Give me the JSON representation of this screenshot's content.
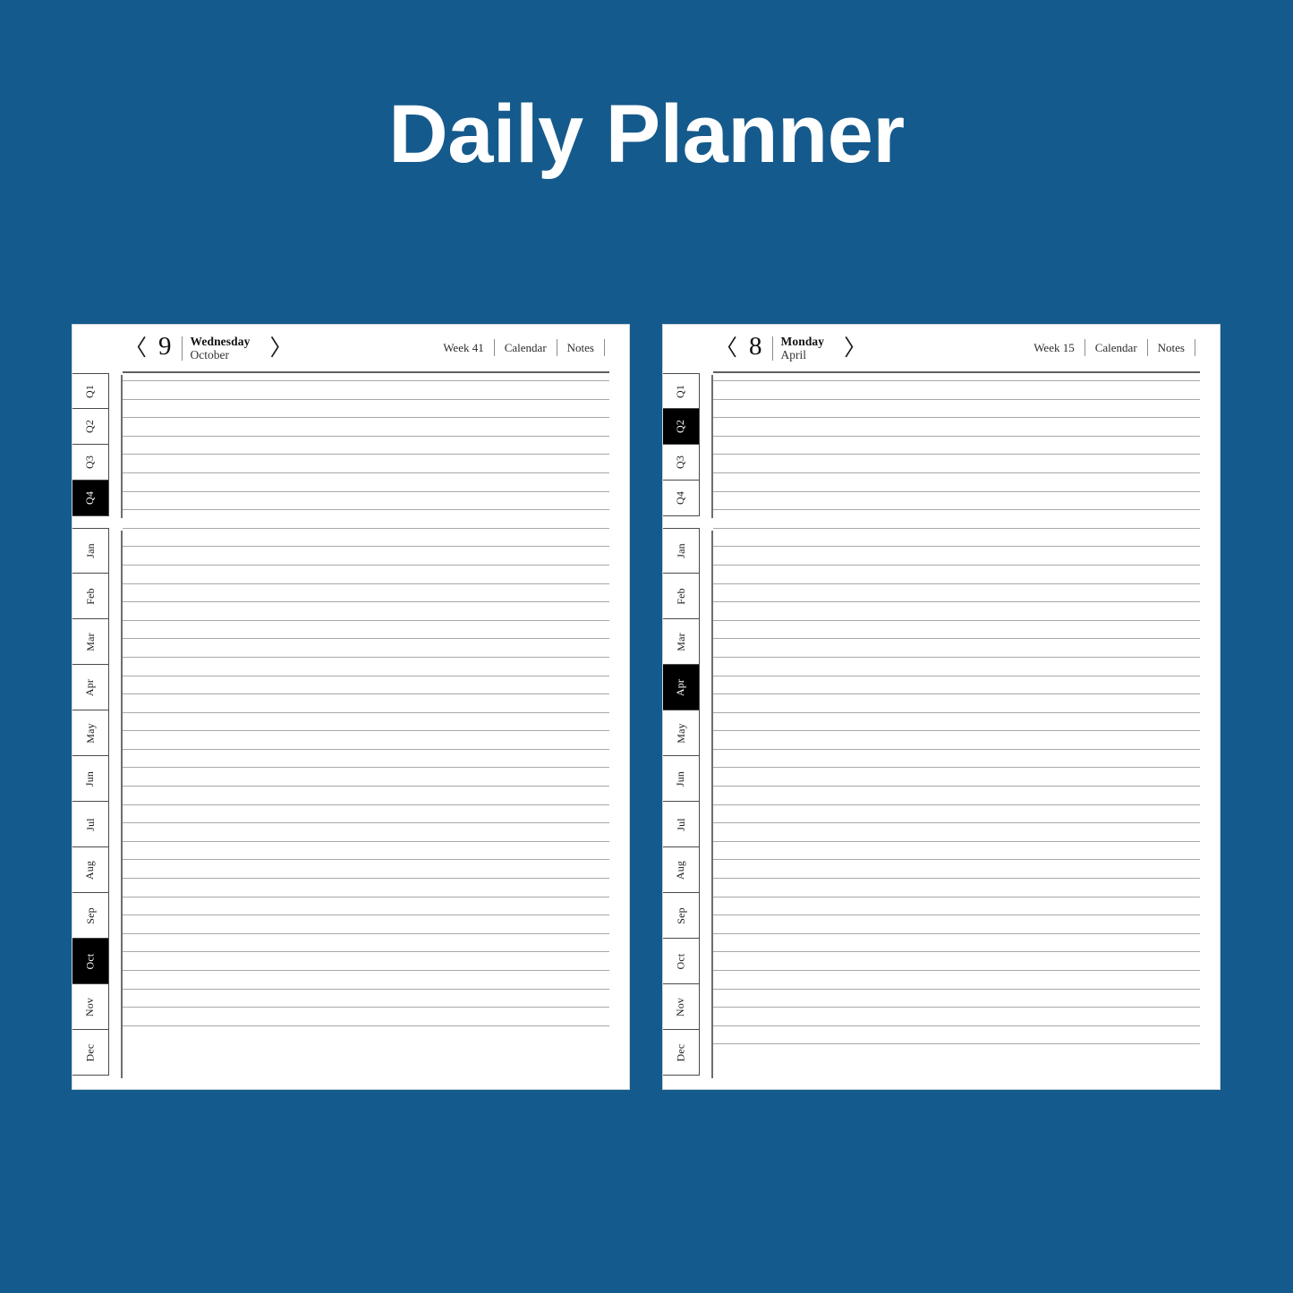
{
  "poster": {
    "title": "Daily Planner",
    "background_color": "#155A8C",
    "title_color": "#FFFFFF"
  },
  "accent": {
    "active_tab_bg": "#000000",
    "active_tab_text": "#FFFFFF",
    "rule_line_color": "#A8A8A8",
    "page_bg": "#FFFFFF"
  },
  "common": {
    "prev_icon": "〈",
    "next_icon": "〉",
    "quarter_tabs": [
      "Q1",
      "Q2",
      "Q3",
      "Q4"
    ],
    "month_tabs": [
      "Jan",
      "Feb",
      "Mar",
      "Apr",
      "May",
      "Jun",
      "Jul",
      "Aug",
      "Sep",
      "Oct",
      "Nov",
      "Dec"
    ],
    "header_links": [
      "Calendar",
      "Notes"
    ]
  },
  "pages": [
    {
      "side": "left",
      "day_number": "9",
      "weekday": "Wednesday",
      "month": "October",
      "week_label": "Week 41",
      "calendar_label": "Calendar",
      "notes_label": "Notes",
      "active_quarter": "Q4",
      "active_month": "Oct",
      "rule_count": 36
    },
    {
      "side": "right",
      "day_number": "8",
      "weekday": "Monday",
      "month": "April",
      "week_label": "Week 15",
      "calendar_label": "Calendar",
      "notes_label": "Notes",
      "active_quarter": "Q2",
      "active_month": "Apr",
      "rule_count": 37
    }
  ]
}
